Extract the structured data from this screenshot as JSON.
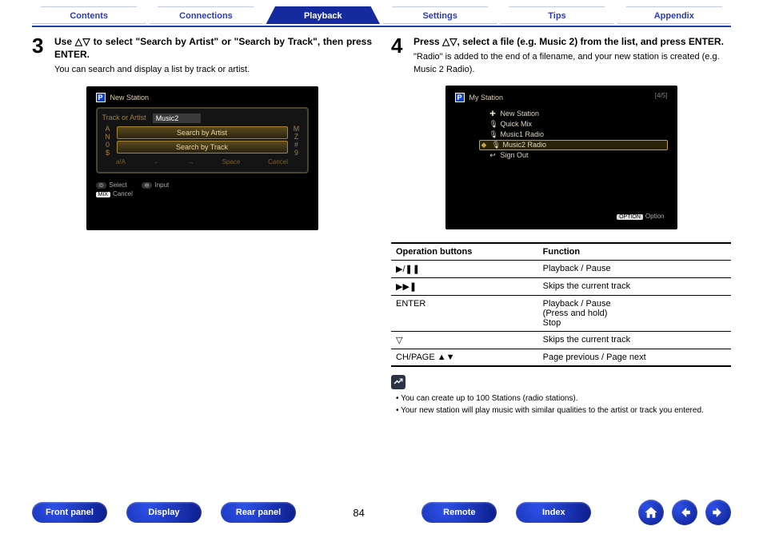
{
  "tabs": [
    "Contents",
    "Connections",
    "Playback",
    "Settings",
    "Tips",
    "Appendix"
  ],
  "active_tab_index": 2,
  "step3": {
    "num": "3",
    "title": "Use △▽ to select \"Search by Artist\" or \"Search by Track\", then press ENTER.",
    "desc": "You can search and display a list by track or artist.",
    "screen": {
      "header": "New Station",
      "prompt_label": "Track or Artist",
      "input_value": "Music2",
      "left_col": [
        "A",
        "N",
        "0",
        "$"
      ],
      "right_col": [
        "M",
        "Z",
        "#",
        "9"
      ],
      "options": [
        "Search by Artist",
        "Search by Track"
      ],
      "bottom_keys": [
        "a/A",
        "←",
        "→",
        "Space",
        "Cancel"
      ],
      "hints": [
        {
          "key": "⊙",
          "label": "Select"
        },
        {
          "key": "⊖",
          "label": "Input"
        },
        {
          "key": "MIX",
          "label": "Cancel"
        }
      ]
    }
  },
  "step4": {
    "num": "4",
    "title": "Press △▽, select a file (e.g. Music 2) from the list, and press ENTER.",
    "desc": "\"Radio\" is added to the end of a filename, and your new station is created (e.g. Music 2 Radio).",
    "screen": {
      "header": "My Station",
      "counter": "[4/5]",
      "items": [
        {
          "icon": "plus",
          "label": "New Station"
        },
        {
          "icon": "mic",
          "label": "Quick Mix"
        },
        {
          "icon": "mic",
          "label": "Music1 Radio"
        },
        {
          "icon": "mic",
          "label": "Music2 Radio",
          "selected": true
        },
        {
          "icon": "exit",
          "label": "Sign Out"
        }
      ],
      "option_label": "Option",
      "option_tag": "OPTION"
    }
  },
  "table": {
    "headers": [
      "Operation buttons",
      "Function"
    ],
    "rows": [
      {
        "op": "▶/❚❚",
        "fn": "Playback / Pause"
      },
      {
        "op": "▶▶❚",
        "fn": "Skips the current track"
      },
      {
        "op": "ENTER",
        "fn": "Playback / Pause\n(Press and hold)\nStop"
      },
      {
        "op": "▽",
        "fn": "Skips the current track"
      },
      {
        "op": "CH/PAGE ▲▼",
        "fn": "Page previous / Page next"
      }
    ]
  },
  "notes": [
    "You can create up to 100 Stations (radio stations).",
    "Your new station will play music with similar qualities to the artist or track you entered."
  ],
  "bottom": {
    "left_pills": [
      "Front panel",
      "Display",
      "Rear panel"
    ],
    "page": "84",
    "right_pills": [
      "Remote",
      "Index"
    ]
  }
}
